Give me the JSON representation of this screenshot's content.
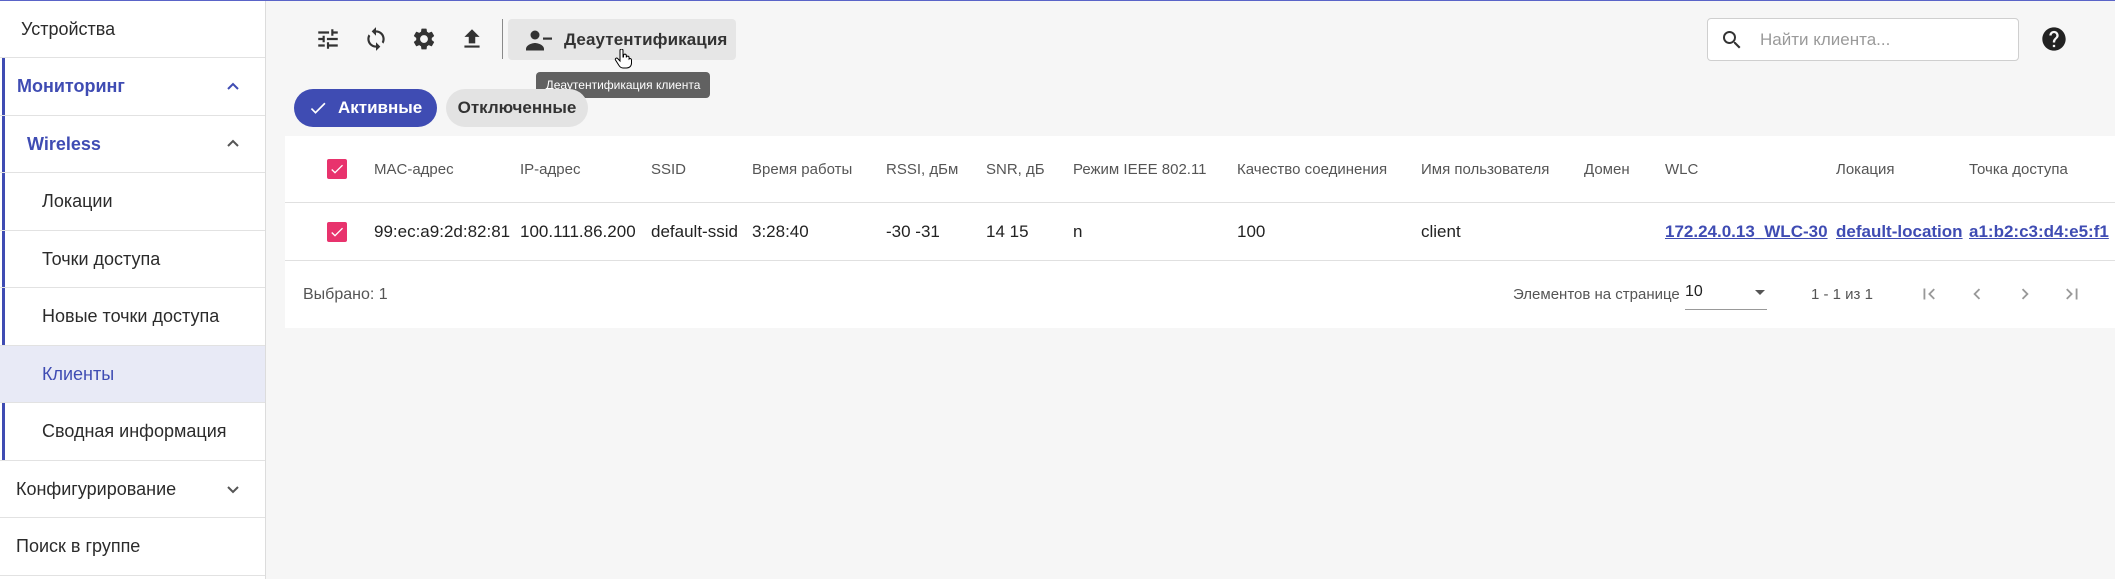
{
  "sidebar": {
    "devices": "Устройства",
    "monitoring": "Мониторинг",
    "wireless": "Wireless",
    "items": [
      "Локации",
      "Точки доступа",
      "Новые точки доступа",
      "Клиенты",
      "Сводная информация"
    ],
    "configuration": "Конфигурирование",
    "group_search": "Поиск в группе"
  },
  "toolbar": {
    "deauth_label": "Деаутентификация",
    "tooltip": "Деаутентификация клиента",
    "search_placeholder": "Найти клиента..."
  },
  "filters": {
    "active": "Активные",
    "disconnected": "Отключенные"
  },
  "table": {
    "headers": [
      "MAC-адрес",
      "IP-адрес",
      "SSID",
      "Время работы",
      "RSSI, дБм",
      "SNR, дБ",
      "Режим IEEE 802.11",
      "Качество соединения",
      "Имя пользователя",
      "Домен",
      "WLC",
      "Локация",
      "Точка доступа"
    ],
    "rows": [
      [
        "99:ec:a9:2d:82:81",
        "100.111.86.200",
        "default-ssid",
        "3:28:40",
        "-30 -31",
        "14 15",
        "n",
        "100",
        "client",
        "",
        "172.24.0.13_WLC-30",
        "default-location",
        "a1:b2:c3:d4:e5:f1"
      ]
    ]
  },
  "footer": {
    "selected": "Выбрано: 1",
    "per_page_label": "Элементов на странице",
    "per_page_value": "10",
    "range": "1 - 1 из 1"
  },
  "colors": {
    "accent": "#3f4cb3",
    "checkbox": "#e8336d"
  }
}
